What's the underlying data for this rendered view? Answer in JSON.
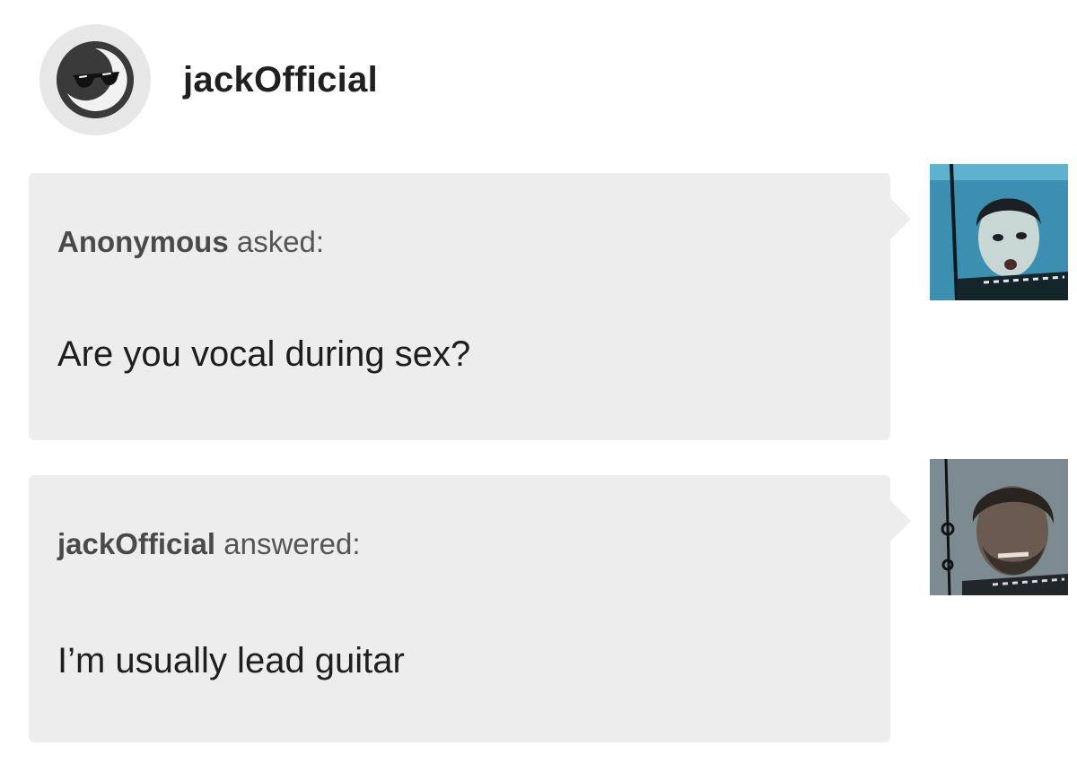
{
  "header": {
    "username": "jackOfficial",
    "avatar_icon": "sunglasses-icon"
  },
  "ask": {
    "author": "Anonymous",
    "verb": "asked:",
    "message": "Are you vocal during sex?",
    "avatar_icon": "face-photo"
  },
  "answer": {
    "author": "jackOfficial",
    "verb": "answered:",
    "message": "I’m usually lead guitar",
    "avatar_icon": "face-photo"
  },
  "colors": {
    "bubble": "#ededed",
    "avatar_ring": "#e7e7e7",
    "text": "#2b2b2b"
  }
}
